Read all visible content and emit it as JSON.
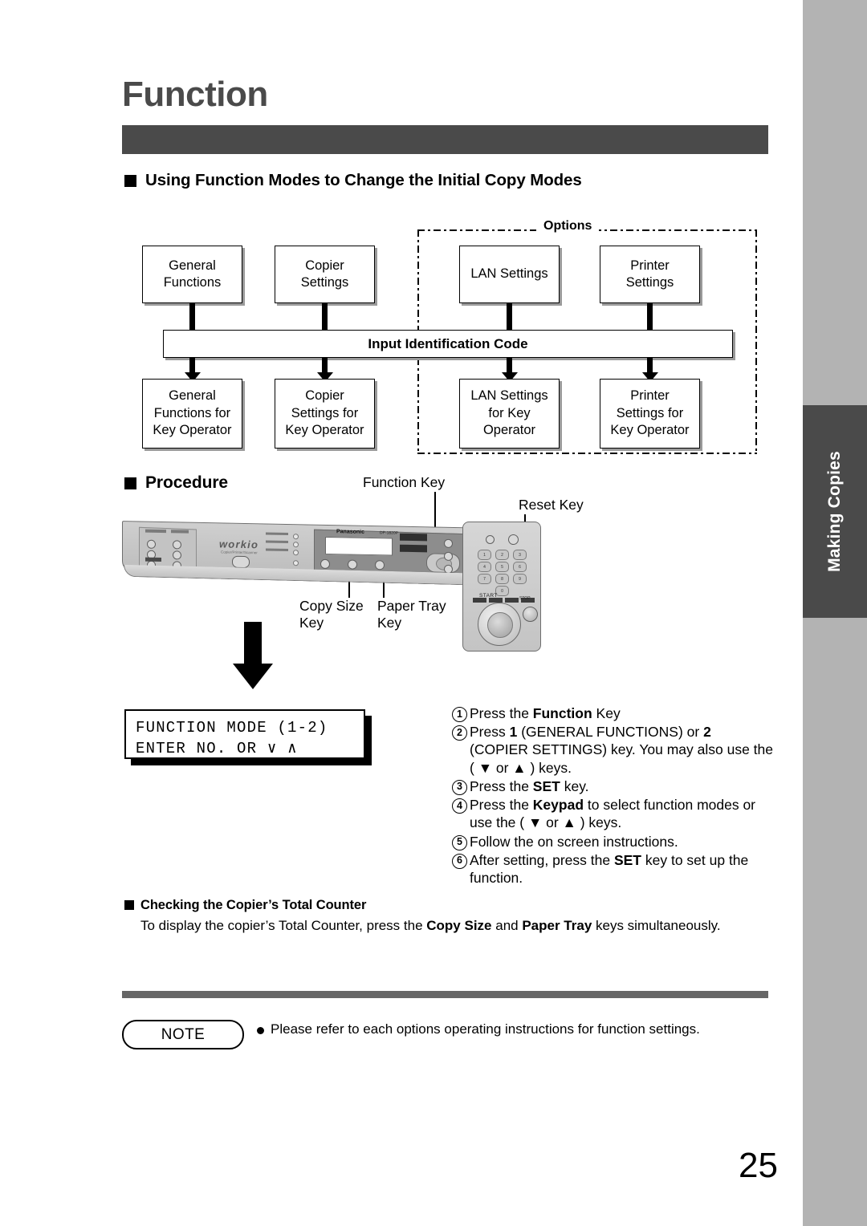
{
  "page": {
    "title": "Function",
    "number": "25"
  },
  "sidebar": {
    "tab_label": "Making Copies"
  },
  "sections": {
    "using_heading": "Using Function Modes to Change the Initial Copy Modes",
    "procedure_heading": "Procedure",
    "counter_heading": "Checking the Copier’s Total Counter"
  },
  "flowchart": {
    "options_label": "Options",
    "id_bar": "Input Identification Code",
    "top_boxes": [
      "General\nFunctions",
      "Copier\nSettings",
      "LAN Settings",
      "Printer\nSettings"
    ],
    "bottom_boxes": [
      "General\nFunctions for\nKey Operator",
      "Copier\nSettings for\nKey Operator",
      "LAN Settings\nfor Key\nOperator",
      "Printer\nSettings for\nKey Operator"
    ]
  },
  "panel": {
    "brand": "Panasonic",
    "model": "DP-1820P",
    "workio": "workio",
    "workio_sub": "Copier/Printer/Scanner",
    "start_label": "START",
    "stop_label": "STOP",
    "keys": [
      "1",
      "2",
      "3",
      "4",
      "5",
      "6",
      "7",
      "8",
      "9",
      "0"
    ],
    "callouts": {
      "function_key": "Function Key",
      "reset_key": "Reset Key",
      "copy_size_key": "Copy Size\nKey",
      "paper_tray_key": "Paper Tray\nKey"
    }
  },
  "lcd": {
    "line1": "FUNCTION MODE  (1-2)",
    "line2": "ENTER NO. OR ∨ ∧"
  },
  "steps": [
    {
      "num": "1",
      "html": "Press the <b>Function</b> Key"
    },
    {
      "num": "2",
      "html": "Press <b>1</b> (GENERAL FUNCTIONS) or <b>2</b> (COPIER SETTINGS) key. You may also use the ( ▼ or ▲ ) keys."
    },
    {
      "num": "3",
      "html": "Press the <b>SET</b> key."
    },
    {
      "num": "4",
      "html": "Press the <b>Keypad</b> to select function modes or use the ( ▼ or ▲ ) keys."
    },
    {
      "num": "5",
      "html": "Follow the on screen instructions."
    },
    {
      "num": "6",
      "html": "After setting, press the <b>SET</b> key to set up the function."
    }
  ],
  "counter": {
    "body_html": "To display the copier’s Total Counter, press the <b>Copy Size</b> and <b>Paper Tray</b> keys simultaneously."
  },
  "note": {
    "label": "NOTE",
    "text": "Please refer to each options operating instructions for function settings."
  },
  "colors": {
    "header_bar": "#4a4a4a",
    "sidebar_strip": "#b3b3b3",
    "sidebar_tab": "#4a4a4a",
    "note_rule": "#666666"
  }
}
